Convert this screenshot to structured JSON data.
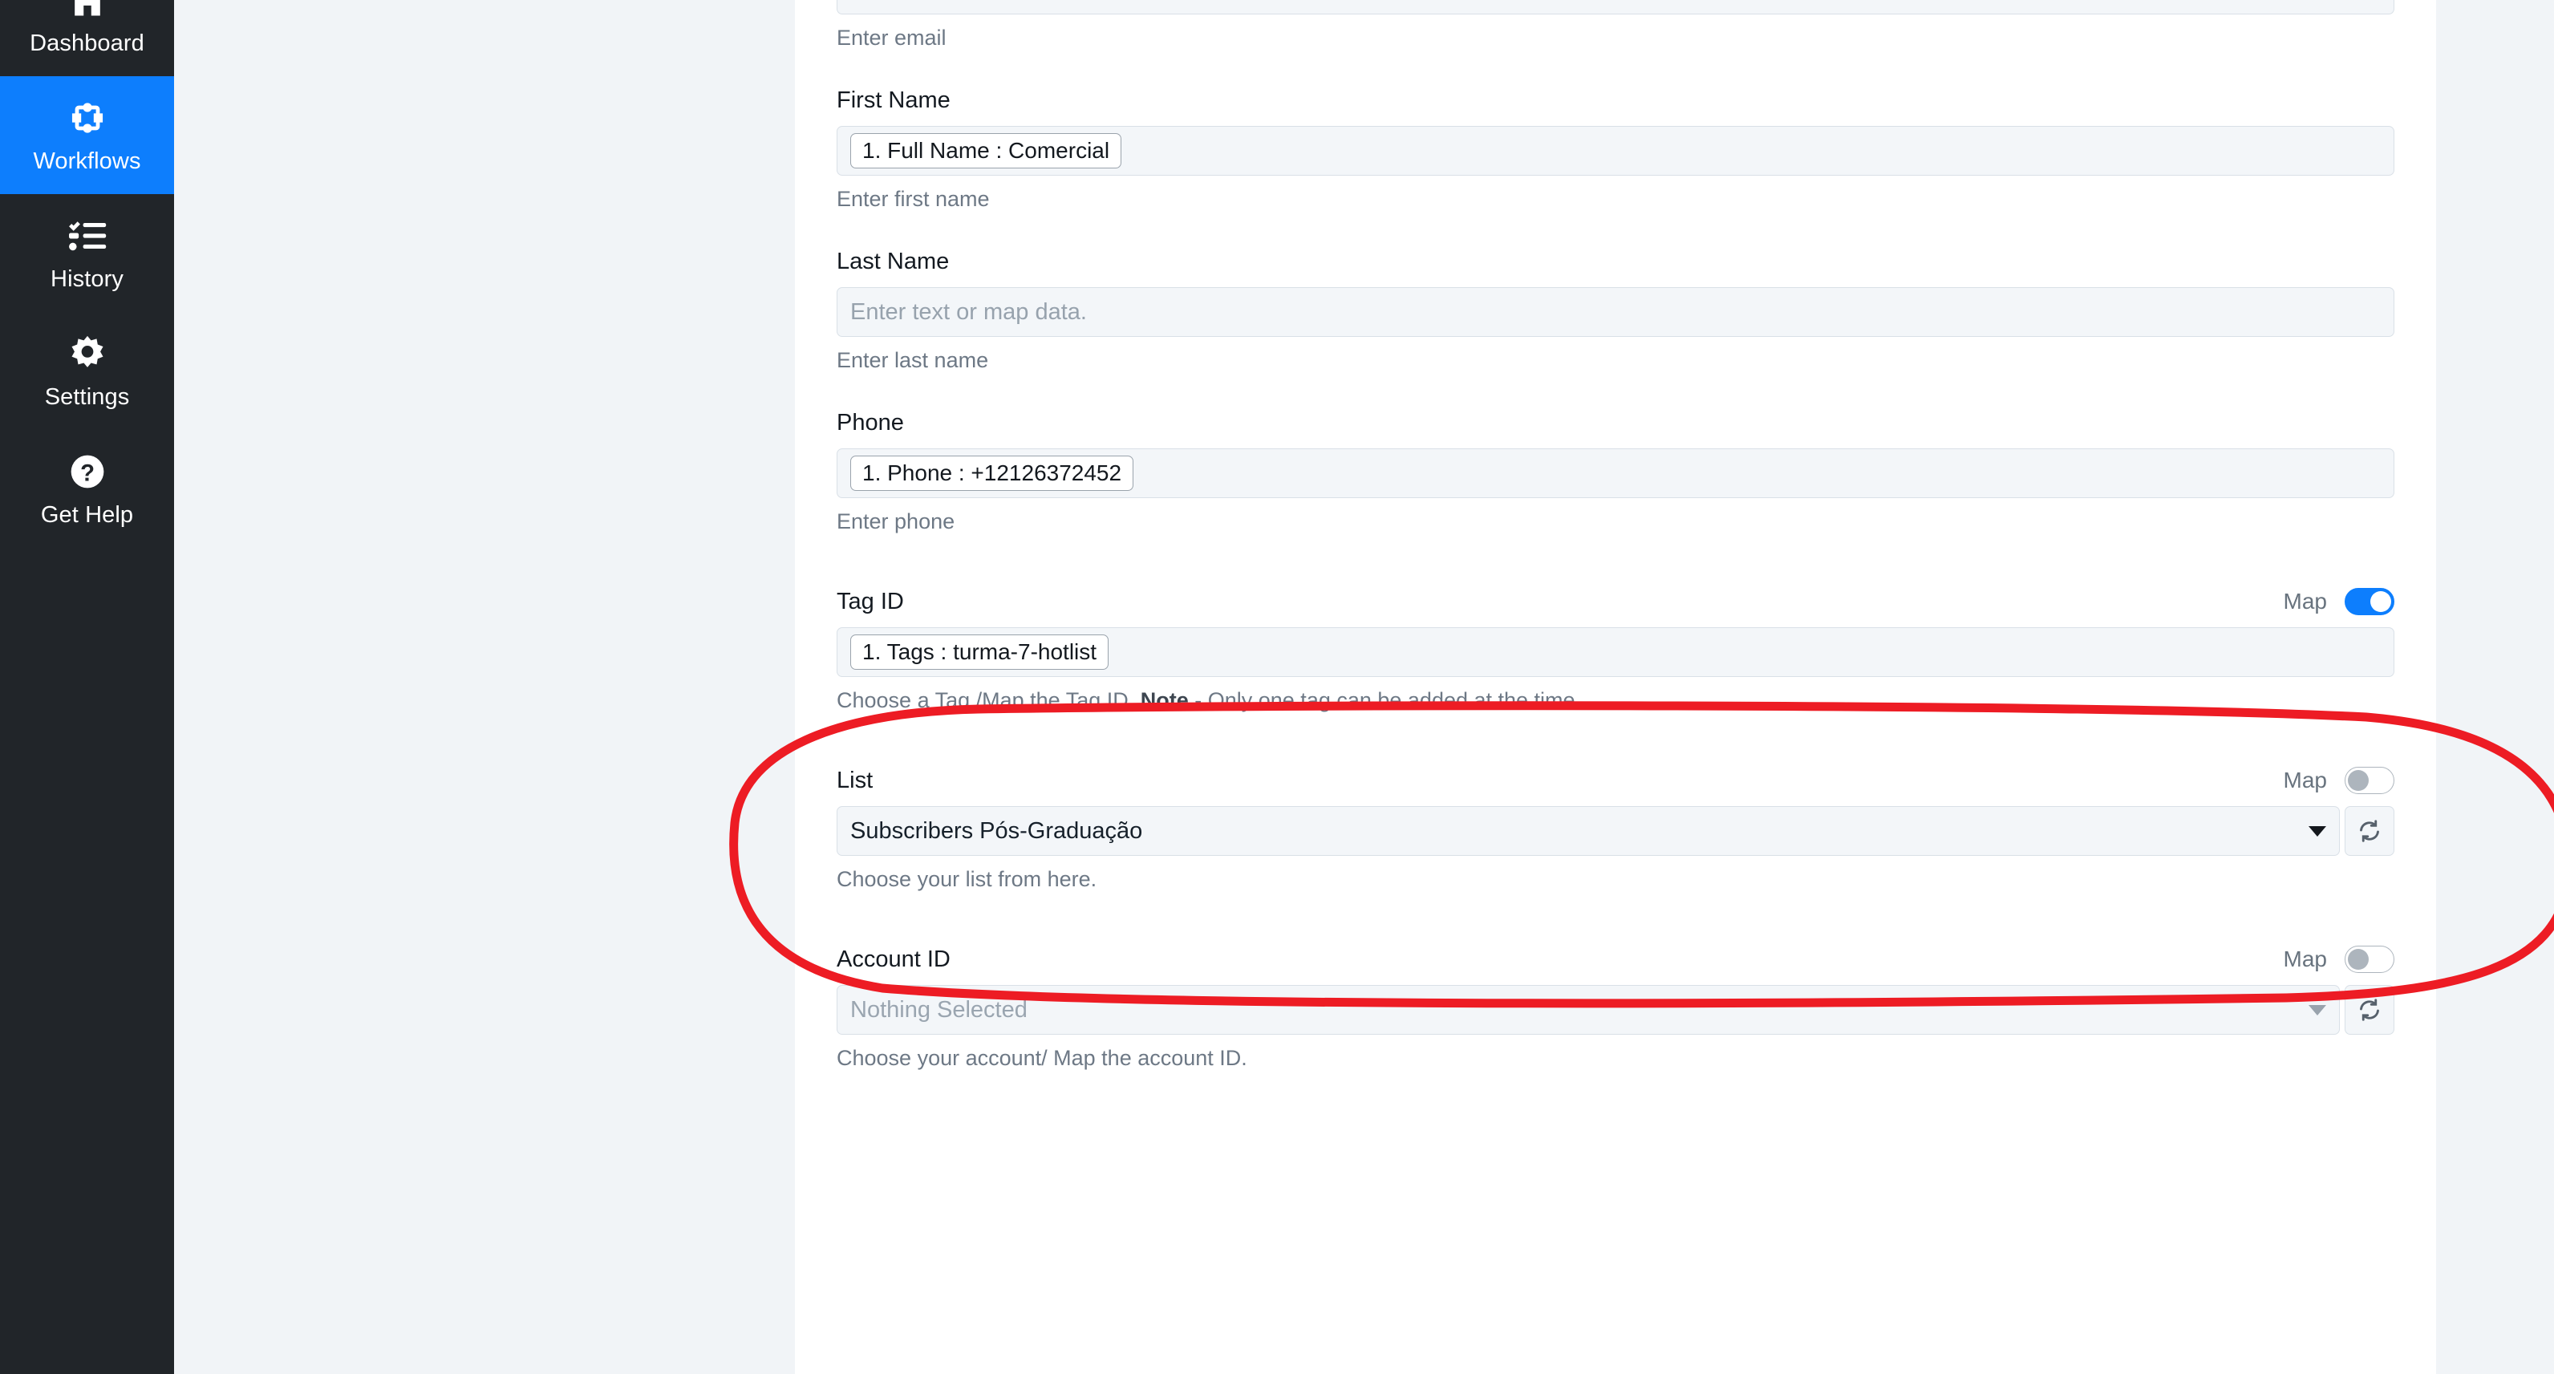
{
  "sidebar": {
    "items": [
      {
        "label": "Dashboard",
        "icon": "home-icon",
        "active": false
      },
      {
        "label": "Workflows",
        "icon": "workflow-icon",
        "active": true
      },
      {
        "label": "History",
        "icon": "history-list-icon",
        "active": false
      },
      {
        "label": "Settings",
        "icon": "gear-icon",
        "active": false
      },
      {
        "label": "Get Help",
        "icon": "question-circle-icon",
        "active": false
      }
    ]
  },
  "form": {
    "email": {
      "helper": "Enter email"
    },
    "first_name": {
      "label": "First Name",
      "chip": "1. Full Name : Comercial",
      "helper": "Enter first name"
    },
    "last_name": {
      "label": "Last Name",
      "placeholder": "Enter text or map data.",
      "helper": "Enter last name"
    },
    "phone": {
      "label": "Phone",
      "chip": "1. Phone : +12126372452",
      "helper": "Enter phone"
    },
    "tag_id": {
      "label": "Tag ID",
      "map_label": "Map",
      "map_on": true,
      "chip": "1. Tags : turma-7-hotlist",
      "helper_prefix": "Choose a Tag /Map the Tag ID. ",
      "helper_bold": "Note",
      "helper_suffix": " - Only one tag can be added at the time."
    },
    "list": {
      "label": "List",
      "map_label": "Map",
      "map_on": false,
      "value": "Subscribers Pós-Graduação",
      "helper": "Choose your list from here.",
      "refresh_icon": "refresh-icon",
      "caret_icon": "chevron-down-icon"
    },
    "account_id": {
      "label": "Account ID",
      "map_label": "Map",
      "map_on": false,
      "value": "Nothing Selected",
      "helper": "Choose your account/ Map the account ID.",
      "refresh_icon": "refresh-icon",
      "caret_icon": "chevron-down-icon"
    }
  },
  "annotation": {
    "shape": "red-ellipse-highlight",
    "color": "#ed1c24",
    "target": "Tag ID"
  },
  "colors": {
    "accent": "#0d7efd",
    "sidebar_bg": "#212529",
    "page_bg": "#f1f4f7",
    "panel_bg": "#ffffff",
    "input_bg": "#f3f6f9",
    "annotation_red": "#ed1c24"
  }
}
